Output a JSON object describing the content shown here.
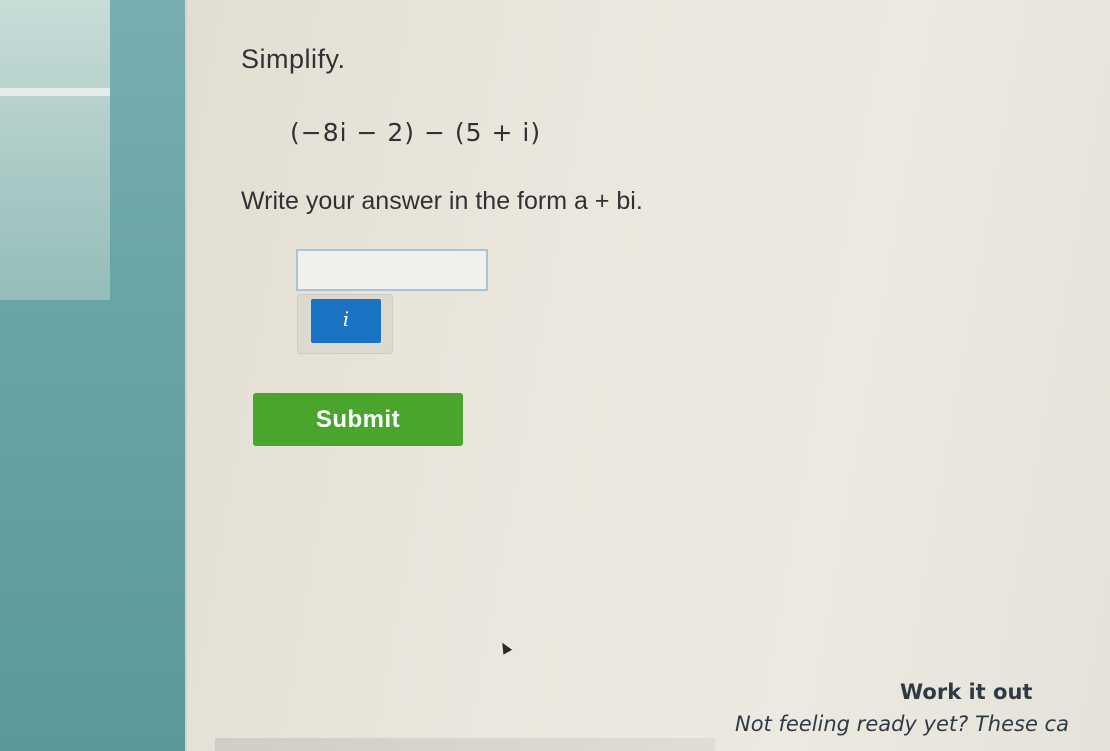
{
  "question": {
    "heading": "Simplify.",
    "expression": "(−8i − 2) − (5 + i)",
    "instruction": "Write your answer in the form a + bi."
  },
  "answer": {
    "value": "",
    "keypad_key": "i"
  },
  "submit_label": "Submit",
  "work_it_out": {
    "title": "Work it out",
    "description": "Not feeling ready yet? These ca"
  },
  "colors": {
    "submit": "#4aa52c",
    "keypad_key": "#1b73c4",
    "input_border": "#a9c4d8"
  }
}
